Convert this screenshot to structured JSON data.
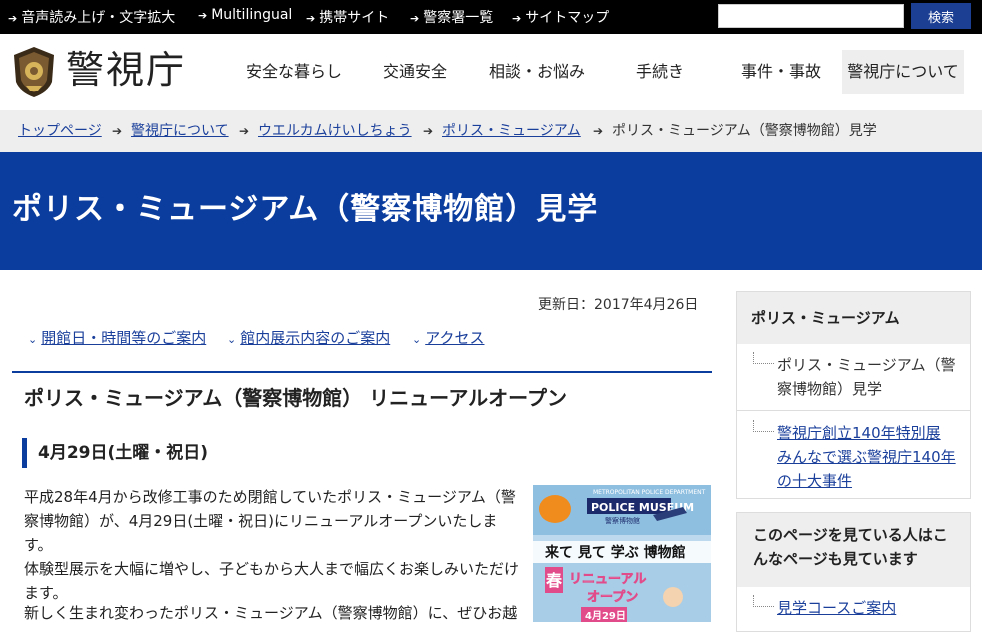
{
  "utility": {
    "links": [
      "音声読み上げ・文字拡大",
      "Multilingual",
      "携帯サイト",
      "警察署一覧",
      "サイトマップ"
    ],
    "search_placeholder": "",
    "search_button": "検索"
  },
  "header": {
    "logo_text": "警視庁",
    "nav": [
      "安全な暮らし",
      "交通安全",
      "相談・お悩み",
      "手続き",
      "事件・事故",
      "警視庁について"
    ]
  },
  "breadcrumb": {
    "links": [
      "トップページ",
      "警視庁について",
      "ウエルカムけいしちょう",
      "ポリス・ミュージアム"
    ],
    "current": "ポリス・ミュージアム（警察博物館）見学"
  },
  "page_title": "ポリス・ミュージアム（警察博物館）見学",
  "updated": "更新日：2017年4月26日",
  "anchors": [
    "開館日・時間等のご案内",
    "館内展示内容のご案内",
    "アクセス"
  ],
  "section": {
    "heading": "ポリス・ミュージアム（警察博物館） リニューアルオープン",
    "subheading": "4月29日(土曜・祝日)",
    "para1": "平成28年4月から改修工事のため閉館していたポリス・ミュージアム（警察博物館）が、4月29日(土曜・祝日)にリニューアルオープンいたします。",
    "para1b": "体験型展示を大幅に増やし、子どもから大人まで幅広くお楽しみいただけます。",
    "para2": "新しく生まれ変わったポリス・ミュージアム（警察博物館）に、ぜひお越"
  },
  "poster": {
    "top": "METROPOLITAN POLICE DEPARTMENT",
    "logo": "POLICE MUSEUM",
    "logo_sub": "警察博物館",
    "tagline": "来て 見て 学ぶ 博物館",
    "spring": "春",
    "renewal": "リニューアル",
    "open": "オープン",
    "date": "4月29日"
  },
  "sidebar": {
    "box1_title": "ポリス・ミュージアム",
    "box1_items": [
      "ポリス・ミュージアム（警察博物館）見学",
      "警視庁創立140年特別展 みんなで選ぶ警視庁140年の十大事件"
    ],
    "box2_title": "このページを見ている人はこんなページも見ています",
    "box2_items": [
      "見学コースご案内"
    ]
  },
  "colors": {
    "brand_blue": "#0b3d9f",
    "link": "#1a3f9b",
    "utility_bg": "#000000",
    "breadcrumb_bg": "#eeeeee"
  }
}
